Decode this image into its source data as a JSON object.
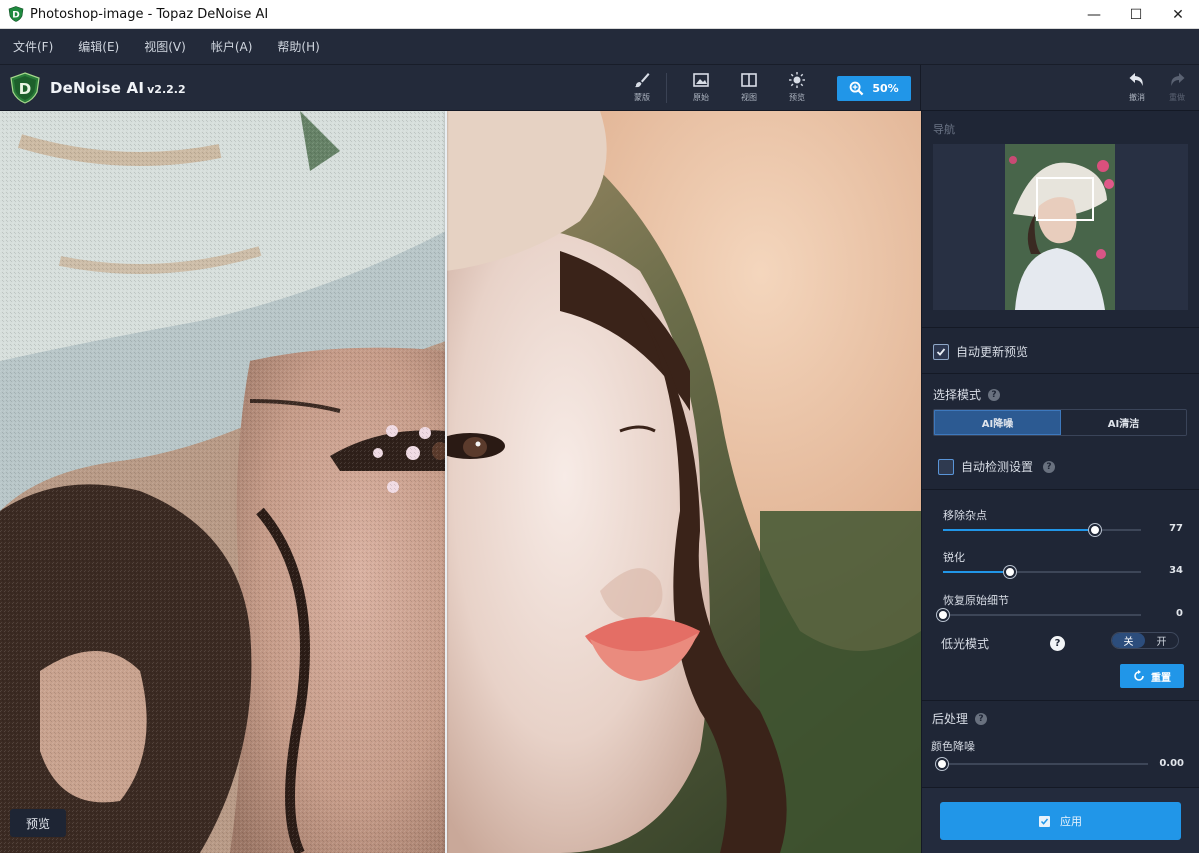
{
  "window": {
    "title": "Photoshop-image - Topaz DeNoise AI",
    "controls": {
      "minimize": "—",
      "maximize": "☐",
      "close": "✕"
    }
  },
  "menu": {
    "items": [
      "文件(F)",
      "编辑(E)",
      "视图(V)",
      "帐户(A)",
      "帮助(H)"
    ]
  },
  "toolbar": {
    "app_name": "DeNoise AI",
    "version": "v2.2.2",
    "tools": [
      {
        "label": "蒙版",
        "icon": "brush-icon"
      },
      {
        "label": "原始",
        "icon": "image-icon"
      },
      {
        "label": "视图",
        "icon": "split-view-icon"
      },
      {
        "label": "预览",
        "icon": "sun-icon"
      }
    ],
    "zoom_label": "50%",
    "undo_label": "撤消",
    "redo_label": "重做"
  },
  "canvas": {
    "preview_button": "预览",
    "split_fraction": 0.484
  },
  "panel": {
    "navigator_title": "导航",
    "auto_update_label": "自动更新预览",
    "auto_update_checked": true,
    "select_mode_label": "选择模式",
    "modes": [
      "AI降噪",
      "AI清洁"
    ],
    "active_mode": "AI降噪",
    "auto_detect_label": "自动检测设置",
    "auto_detect_checked": false,
    "sliders": [
      {
        "label": "移除杂点",
        "value": "77",
        "fraction": 0.77
      },
      {
        "label": "锐化",
        "value": "34",
        "fraction": 0.34
      },
      {
        "label": "恢复原始细节",
        "value": "0",
        "fraction": 0.0
      }
    ],
    "low_light_label": "低光模式",
    "low_light_off": "关",
    "low_light_on": "开",
    "low_light_state": "关",
    "reset_label": "重置",
    "post_title": "后处理",
    "color_denoise_label": "颜色降噪",
    "color_denoise_value": "0.00",
    "color_denoise_fraction": 0.0,
    "apply_label": "应用"
  },
  "colors": {
    "accent": "#2196e8",
    "panel_bg": "#1f2636",
    "toolbar_bg": "#232a3a"
  }
}
